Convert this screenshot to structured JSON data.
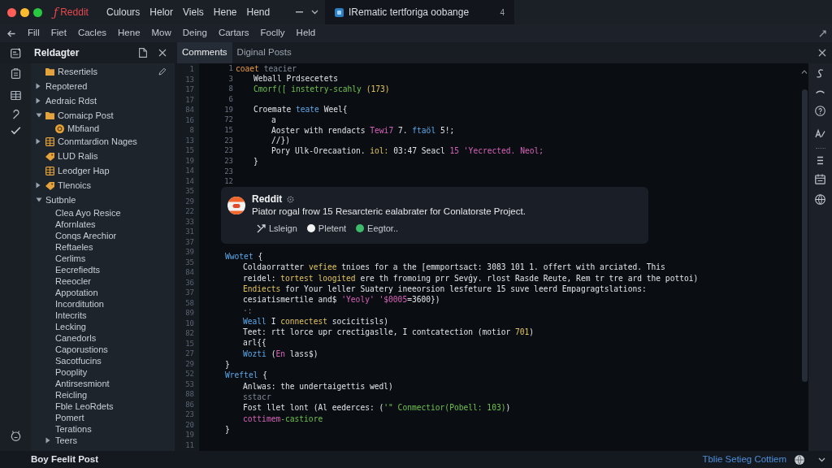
{
  "window": {
    "logo": "ƒ",
    "app_name": "Reddit",
    "menus": [
      "Culours",
      "Helor",
      "Viels",
      "Hene",
      "Hend"
    ],
    "document_tab": {
      "title": "IRematic tertforiga oobange",
      "badge": "4"
    }
  },
  "menu_bar": [
    "Fill",
    "Fiet",
    "Cacles",
    "Hene",
    "Mow",
    "Deing",
    "Cartars",
    "Foclly",
    "Held"
  ],
  "sidebar": {
    "title": "Reldagter",
    "items": [
      {
        "label": "Resertiels",
        "kind": "folder"
      },
      {
        "label": "Repotered",
        "kind": "plain",
        "expanded": false
      },
      {
        "label": "Aedraic Rdst",
        "kind": "plain",
        "expanded": false
      },
      {
        "label": "Comaicp Post",
        "kind": "folder",
        "expanded": true,
        "children": [
          {
            "label": "Mbfiand",
            "kind": "badge"
          }
        ]
      },
      {
        "label": "Conmtardion Nages",
        "kind": "grid",
        "expanded": false
      },
      {
        "label": "LUD Ralis",
        "kind": "tag"
      },
      {
        "label": "Leodger Hap",
        "kind": "grid"
      },
      {
        "label": "Tlenoics",
        "kind": "tag",
        "expanded": false
      },
      {
        "label": "Sutbnle",
        "kind": "plain",
        "expanded": true,
        "children": [
          {
            "label": "Clea Ayo Resice",
            "kind": "plain"
          },
          {
            "label": "Afornlates",
            "kind": "plain"
          },
          {
            "label": "Conqs Arechior",
            "kind": "plain"
          },
          {
            "label": "Reftaeles",
            "kind": "plain"
          },
          {
            "label": "Cerlims",
            "kind": "plain"
          },
          {
            "label": "Eecrefiedts",
            "kind": "plain"
          },
          {
            "label": "Reeocler",
            "kind": "plain"
          },
          {
            "label": "Appotation",
            "kind": "plain"
          },
          {
            "label": "Incorditution",
            "kind": "plain"
          },
          {
            "label": "Intecrits",
            "kind": "plain"
          },
          {
            "label": "Lecking",
            "kind": "plain"
          },
          {
            "label": "Canedorls",
            "kind": "plain"
          },
          {
            "label": "Caporustions",
            "kind": "plain"
          },
          {
            "label": "Sacotfucins",
            "kind": "plain"
          },
          {
            "label": "Pooplity",
            "kind": "plain"
          },
          {
            "label": "Antirsesmiont",
            "kind": "plain"
          },
          {
            "label": "Reicling",
            "kind": "plain"
          },
          {
            "label": "Fble LeoRdets",
            "kind": "plain"
          },
          {
            "label": "Pomert",
            "kind": "plain"
          },
          {
            "label": "Terations",
            "kind": "plain"
          },
          {
            "label": "Teers",
            "kind": "plain",
            "expanded": false
          }
        ]
      }
    ]
  },
  "tabs": [
    {
      "label": "Comments",
      "selected": true
    },
    {
      "label": "Diginal Posts",
      "selected": false
    }
  ],
  "gutter": [
    "1",
    "13",
    "17",
    "17",
    "84",
    "16",
    "8",
    "13",
    "15",
    "19",
    "14",
    "14",
    "35",
    "29",
    "22",
    "33",
    "31",
    "37",
    "39",
    "35",
    "84",
    "36",
    "37",
    "58",
    "89",
    "10",
    "82",
    "15",
    "27",
    "29",
    "52",
    "53",
    "88",
    "86",
    "23",
    "20",
    "19",
    "11"
  ],
  "editor": {
    "blocks": [
      {
        "kind": "numbered_code",
        "lines": [
          {
            "number": "1",
            "tokens": [
              {
                "kind": "decl",
                "text": "coaet "
              },
              {
                "kind": "comment",
                "text": "teacier"
              }
            ],
            "children": [
              {
                "number": "3",
                "tokens": [
                  {
                    "kind": "plain",
                    "text": "Weball Prdsecetets"
                  }
                ]
              },
              {
                "number": "8",
                "tokens": [
                  {
                    "kind": "call",
                    "text": "Cmorf([ instetry-scahly "
                  },
                  {
                    "kind": "literal",
                    "text": "(173)"
                  }
                ]
              },
              {
                "number": "6"
              },
              {
                "number": "19",
                "tokens": [
                  {
                    "kind": "plain",
                    "text": "Croemate "
                  },
                  {
                    "kind": "keyword",
                    "text": "teate"
                  },
                  {
                    "kind": "plain",
                    "text": " Weel{"
                  }
                ],
                "children": [
                  {
                    "number": "72",
                    "tokens": [
                      {
                        "kind": "plain",
                        "text": "a"
                      }
                    ]
                  },
                  {
                    "number": "15",
                    "tokens": [
                      {
                        "kind": "plain",
                        "text": "Aoster with rendacts "
                      },
                      {
                        "kind": "string",
                        "text": "Tewi7"
                      },
                      {
                        "kind": "plain",
                        "text": " 7. "
                      },
                      {
                        "kind": "keyword",
                        "text": "ftaöl"
                      },
                      {
                        "kind": "plain",
                        "text": " 5!;"
                      }
                    ]
                  },
                  {
                    "number": "23",
                    "tokens": [
                      {
                        "kind": "plain",
                        "text": "//})"
                      }
                    ]
                  },
                  {
                    "number": "23",
                    "tokens": [
                      {
                        "kind": "plain",
                        "text": "Pory Ulk-Orecaation. "
                      },
                      {
                        "kind": "literal",
                        "text": "iol:"
                      },
                      {
                        "kind": "plain",
                        "text": " 03:47 Seacl "
                      },
                      {
                        "kind": "string",
                        "text": "15 'Yecrected. Neol;"
                      }
                    ]
                  }
                ]
              },
              {
                "number": "23",
                "tokens": [
                  {
                    "kind": "plain",
                    "text": "}"
                  }
                ]
              }
            ]
          },
          {
            "number": "23"
          },
          {
            "number": "12"
          }
        ]
      },
      {
        "kind": "notification",
        "sender": "Reddit",
        "message": "Piator rogal frow 15 Resarcteric ealabrater for Conlatorste Project.",
        "actions": [
          {
            "kind": "link",
            "label": "Lsleign"
          },
          {
            "kind": "status",
            "label": "Pletent",
            "color": "#f2f2f2"
          },
          {
            "kind": "status",
            "label": "Eegtor..",
            "color": "#3dbb6a"
          }
        ]
      },
      {
        "kind": "code",
        "lines": [
          {
            "tokens": [
              {
                "kind": "keyword",
                "text": "Wwotet"
              },
              {
                "kind": "plain",
                "text": " {"
              }
            ],
            "children": [
              {
                "tokens": [
                  {
                    "kind": "plain",
                    "text": "Coldaorratter "
                  },
                  {
                    "kind": "literal",
                    "text": "vefiee"
                  },
                  {
                    "kind": "plain",
                    "text": " tnioes for a the [emmportsact: 3083 101 1. offert with arciated. This"
                  }
                ]
              },
              {
                "tokens": [
                  {
                    "kind": "plain",
                    "text": "reidel: "
                  },
                  {
                    "kind": "literal",
                    "text": "tortest loogited"
                  },
                  {
                    "kind": "plain",
                    "text": " ere th fromoing prr Sevģy. rlost Rasde Reute, Rem tr tre ard the pottoi)"
                  }
                ]
              },
              {
                "tokens": [
                  {
                    "kind": "literal",
                    "text": "Endiects"
                  },
                  {
                    "kind": "plain",
                    "text": " for Your leller Suatery ineeorsion lesfeture 15 suve leerd Empagragtslations:"
                  }
                ]
              },
              {
                "tokens": [
                  {
                    "kind": "plain",
                    "text": "cesiatismertile and$ "
                  },
                  {
                    "kind": "string",
                    "text": "'Yeoly' '$0005"
                  },
                  {
                    "kind": "plain",
                    "text": "=3600})"
                  }
                ]
              },
              {
                "tokens": [
                  {
                    "kind": "comment",
                    "text": "·:"
                  }
                ]
              },
              {
                "tokens": [
                  {
                    "kind": "keyword",
                    "text": "Weall"
                  },
                  {
                    "kind": "plain",
                    "text": " I "
                  },
                  {
                    "kind": "literal",
                    "text": "connectest"
                  },
                  {
                    "kind": "plain",
                    "text": " socicitisls)"
                  }
                ]
              },
              {
                "tokens": [
                  {
                    "kind": "plain",
                    "text": "Teet: rtt lorce upr crectigaslle, I contcatection (motior "
                  },
                  {
                    "kind": "literal",
                    "text": "701"
                  },
                  {
                    "kind": "plain",
                    "text": ")"
                  }
                ]
              },
              {
                "tokens": [
                  {
                    "kind": "plain",
                    "text": "arl{{"
                  }
                ]
              },
              {
                "tokens": [
                  {
                    "kind": "keyword",
                    "text": "Wozti"
                  },
                  {
                    "kind": "plain",
                    "text": " ("
                  },
                  {
                    "kind": "string",
                    "text": "En"
                  },
                  {
                    "kind": "plain",
                    "text": " lass$)"
                  }
                ]
              }
            ]
          },
          {
            "tokens": [
              {
                "kind": "plain",
                "text": "}"
              }
            ]
          },
          {
            "tokens": [
              {
                "kind": "keyword",
                "text": "Wreftel"
              },
              {
                "kind": "plain",
                "text": " {"
              }
            ],
            "children": [
              {
                "tokens": [
                  {
                    "kind": "plain",
                    "text": "Anlwas: the undertaigettis wedl)"
                  }
                ]
              },
              {
                "tokens": [
                  {
                    "kind": "comment",
                    "text": "sstacr"
                  }
                ]
              },
              {
                "tokens": [
                  {
                    "kind": "plain",
                    "text": "Fost llet lont (Al eederces: ("
                  },
                  {
                    "kind": "call",
                    "text": "'\" Conmectior(Pobell: 103)"
                  },
                  {
                    "kind": "plain",
                    "text": ")"
                  }
                ]
              },
              {
                "tokens": [
                  {
                    "kind": "string",
                    "text": "cottimem"
                  },
                  {
                    "kind": "call",
                    "text": "-castiore"
                  }
                ]
              }
            ]
          },
          {
            "tokens": [
              {
                "kind": "plain",
                "text": "}"
              }
            ]
          }
        ]
      }
    ]
  },
  "status_bar": {
    "left": "Boy Feelit Post",
    "right": "Tblie Setieg Cottiem"
  }
}
